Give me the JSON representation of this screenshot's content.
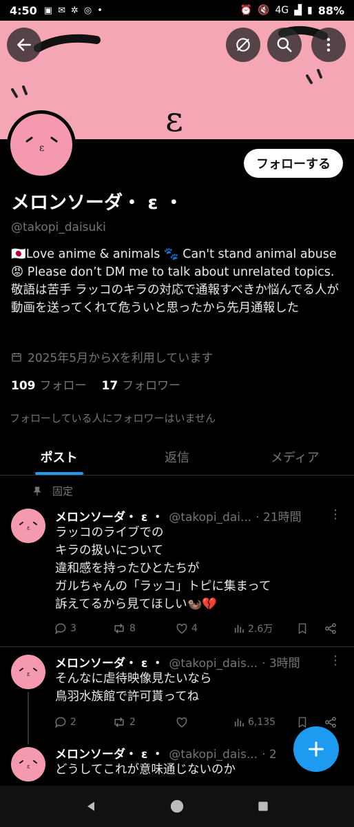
{
  "status_bar": {
    "time": "4:50",
    "network": "4G",
    "battery": "88%"
  },
  "profile": {
    "display_name": "メロンソーダ・ ε ・",
    "handle": "@takopi_daisuki",
    "follow_label": "フォローする",
    "bio": "🇯🇵Love anime & animals 🐾 Can't stand animal abuse 😡 Please don’t DM me to talk about unrelated topics. 敬語は苦手 ラッコのキラの対応で通報すべきか悩んでる人が動画を送ってくれて危ういと思ったから先月通報した",
    "joined": "2025年5月からXを利用しています",
    "following_count": "109",
    "following_label": "フォロー",
    "followers_count": "17",
    "followers_label": "フォロワー",
    "no_mutual": "フォローしている人にフォロワーはいません"
  },
  "tabs": [
    {
      "label": "ポスト",
      "active": true
    },
    {
      "label": "返信",
      "active": false
    },
    {
      "label": "メディア",
      "active": false
    }
  ],
  "pinned_label": "固定",
  "posts": [
    {
      "name": "メロンソーダ・ ε ・",
      "handle": "@takopi_dai...",
      "time": "· 21時間",
      "body": "ラッコのライブでの\nキラの扱いについて\n違和感を持ったひとたちが\nガルちゃんの「ラッコ」トピに集まって\n訴えてるから見てほしい🦦💔",
      "replies": "3",
      "reposts": "8",
      "likes": "4",
      "views": "2.6万"
    },
    {
      "name": "メロンソーダ・ ε ・",
      "handle": "@takopi_dais...",
      "time": "· 3時間",
      "body": "そんなに虐待映像見たいなら\n鳥羽水族館で許可貰ってね",
      "replies": "2",
      "reposts": "2",
      "likes": "",
      "views": "6,135"
    },
    {
      "name": "メロンソーダ・ ε ・",
      "handle": "@takopi_dais...",
      "time": "· 2",
      "body": "どうしてこれが意味通じないのか"
    }
  ],
  "colors": {
    "accent": "#1d9bf0",
    "banner": "#f4a6b4",
    "avatar": "#f59aae"
  },
  "icons": {
    "back": "arrow-left-icon",
    "hide": "eye-slash-icon",
    "search": "search-icon",
    "more": "more-vertical-icon",
    "compose": "plus-icon"
  }
}
